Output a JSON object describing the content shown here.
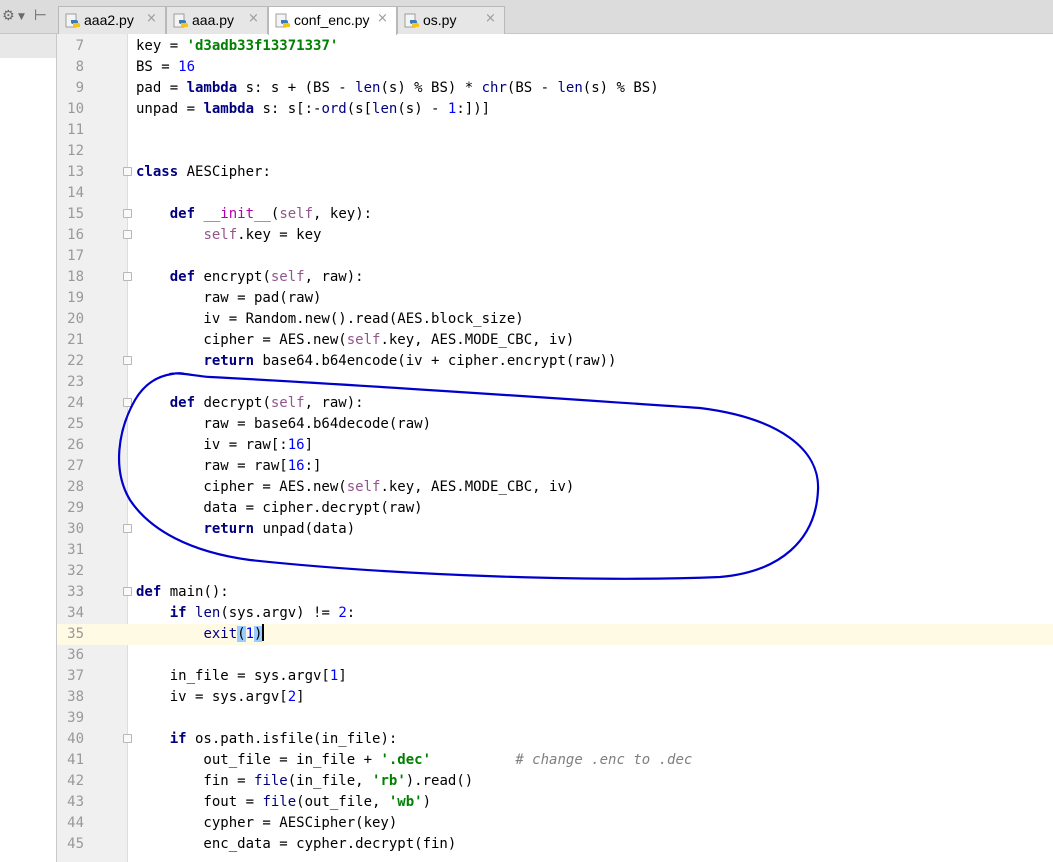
{
  "toolbar": {
    "settings_icon": "gear-icon",
    "collapse_icon": "collapse-icon"
  },
  "tabs": [
    {
      "label": "aaa2.py",
      "active": false,
      "icon": "python-file-icon"
    },
    {
      "label": "aaa.py",
      "active": false,
      "icon": "python-file-icon"
    },
    {
      "label": "conf_enc.py",
      "active": true,
      "icon": "python-file-icon"
    },
    {
      "label": "os.py",
      "active": false,
      "icon": "python-file-icon"
    }
  ],
  "tab_close_glyph": "×",
  "editor": {
    "caret_line": "35",
    "annotation_color": "#0000cc",
    "lines": [
      {
        "n": "7",
        "t": "key = 'd3adb33f13371337'"
      },
      {
        "n": "8",
        "t": "BS = 16"
      },
      {
        "n": "9",
        "t": "pad = lambda s: s + (BS - len(s) % BS) * chr(BS - len(s) % BS)"
      },
      {
        "n": "10",
        "t": "unpad = lambda s: s[:-ord(s[len(s) - 1:])]"
      },
      {
        "n": "11",
        "t": ""
      },
      {
        "n": "12",
        "t": ""
      },
      {
        "n": "13",
        "t": "class AESCipher:"
      },
      {
        "n": "14",
        "t": ""
      },
      {
        "n": "15",
        "t": "    def __init__(self, key):"
      },
      {
        "n": "16",
        "t": "        self.key = key"
      },
      {
        "n": "17",
        "t": ""
      },
      {
        "n": "18",
        "t": "    def encrypt(self, raw):"
      },
      {
        "n": "19",
        "t": "        raw = pad(raw)"
      },
      {
        "n": "20",
        "t": "        iv = Random.new().read(AES.block_size)"
      },
      {
        "n": "21",
        "t": "        cipher = AES.new(self.key, AES.MODE_CBC, iv)"
      },
      {
        "n": "22",
        "t": "        return base64.b64encode(iv + cipher.encrypt(raw))"
      },
      {
        "n": "23",
        "t": ""
      },
      {
        "n": "24",
        "t": "    def decrypt(self, raw):"
      },
      {
        "n": "25",
        "t": "        raw = base64.b64decode(raw)"
      },
      {
        "n": "26",
        "t": "        iv = raw[:16]"
      },
      {
        "n": "27",
        "t": "        raw = raw[16:]"
      },
      {
        "n": "28",
        "t": "        cipher = AES.new(self.key, AES.MODE_CBC, iv)"
      },
      {
        "n": "29",
        "t": "        data = cipher.decrypt(raw)"
      },
      {
        "n": "30",
        "t": "        return unpad(data)"
      },
      {
        "n": "31",
        "t": ""
      },
      {
        "n": "32",
        "t": ""
      },
      {
        "n": "33",
        "t": "def main():"
      },
      {
        "n": "34",
        "t": "    if len(sys.argv) != 2:"
      },
      {
        "n": "35",
        "t": "        exit(1)"
      },
      {
        "n": "36",
        "t": ""
      },
      {
        "n": "37",
        "t": "    in_file = sys.argv[1]"
      },
      {
        "n": "38",
        "t": "    iv = sys.argv[2]"
      },
      {
        "n": "39",
        "t": ""
      },
      {
        "n": "40",
        "t": "    if os.path.isfile(in_file):"
      },
      {
        "n": "41",
        "t": "        out_file = in_file + '.dec'          # change .enc to .dec"
      },
      {
        "n": "42",
        "t": "        fin = file(in_file, 'rb').read()"
      },
      {
        "n": "43",
        "t": "        fout = file(out_file, 'wb')"
      },
      {
        "n": "44",
        "t": "        cypher = AESCipher(key)"
      },
      {
        "n": "45",
        "t": "        enc_data = cypher.decrypt(fin)"
      }
    ]
  }
}
